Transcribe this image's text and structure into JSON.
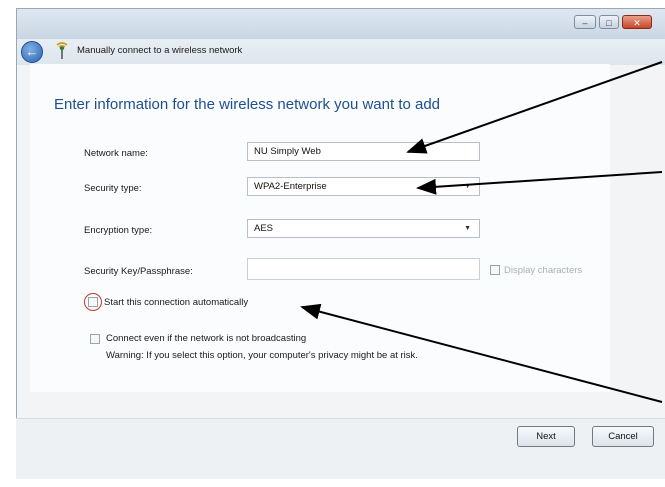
{
  "window": {
    "title": "Manually connect to a wireless network",
    "buttons": {
      "minimize": "–",
      "maximize": "□",
      "close": "✕"
    }
  },
  "form": {
    "heading": "Enter information for the wireless network you want to add",
    "network_name": {
      "label": "Network name:",
      "value": "NU Simply Web"
    },
    "security_type": {
      "label": "Security type:",
      "value": "WPA2-Enterprise"
    },
    "encryption_type": {
      "label": "Encryption type:",
      "value": "AES"
    },
    "security_key": {
      "label": "Security Key/Passphrase:",
      "value": ""
    },
    "display_characters": {
      "label": "Display characters",
      "checked": false
    },
    "start_automatically": {
      "label": "Start this connection automatically",
      "checked": false
    },
    "connect_not_broadcasting": {
      "label": "Connect even if the network is not broadcasting",
      "checked": false
    },
    "warning": "Warning: If you select this option, your computer's privacy might be at risk."
  },
  "actions": {
    "next": "Next",
    "cancel": "Cancel"
  },
  "icons": {
    "back": "back-arrow-icon",
    "network": "wireless-network-icon",
    "dropdown": "chevron-down-icon"
  },
  "colors": {
    "heading": "#1e4f90",
    "annotation_arrow": "#000000",
    "highlight_circle": "#c0392b"
  }
}
